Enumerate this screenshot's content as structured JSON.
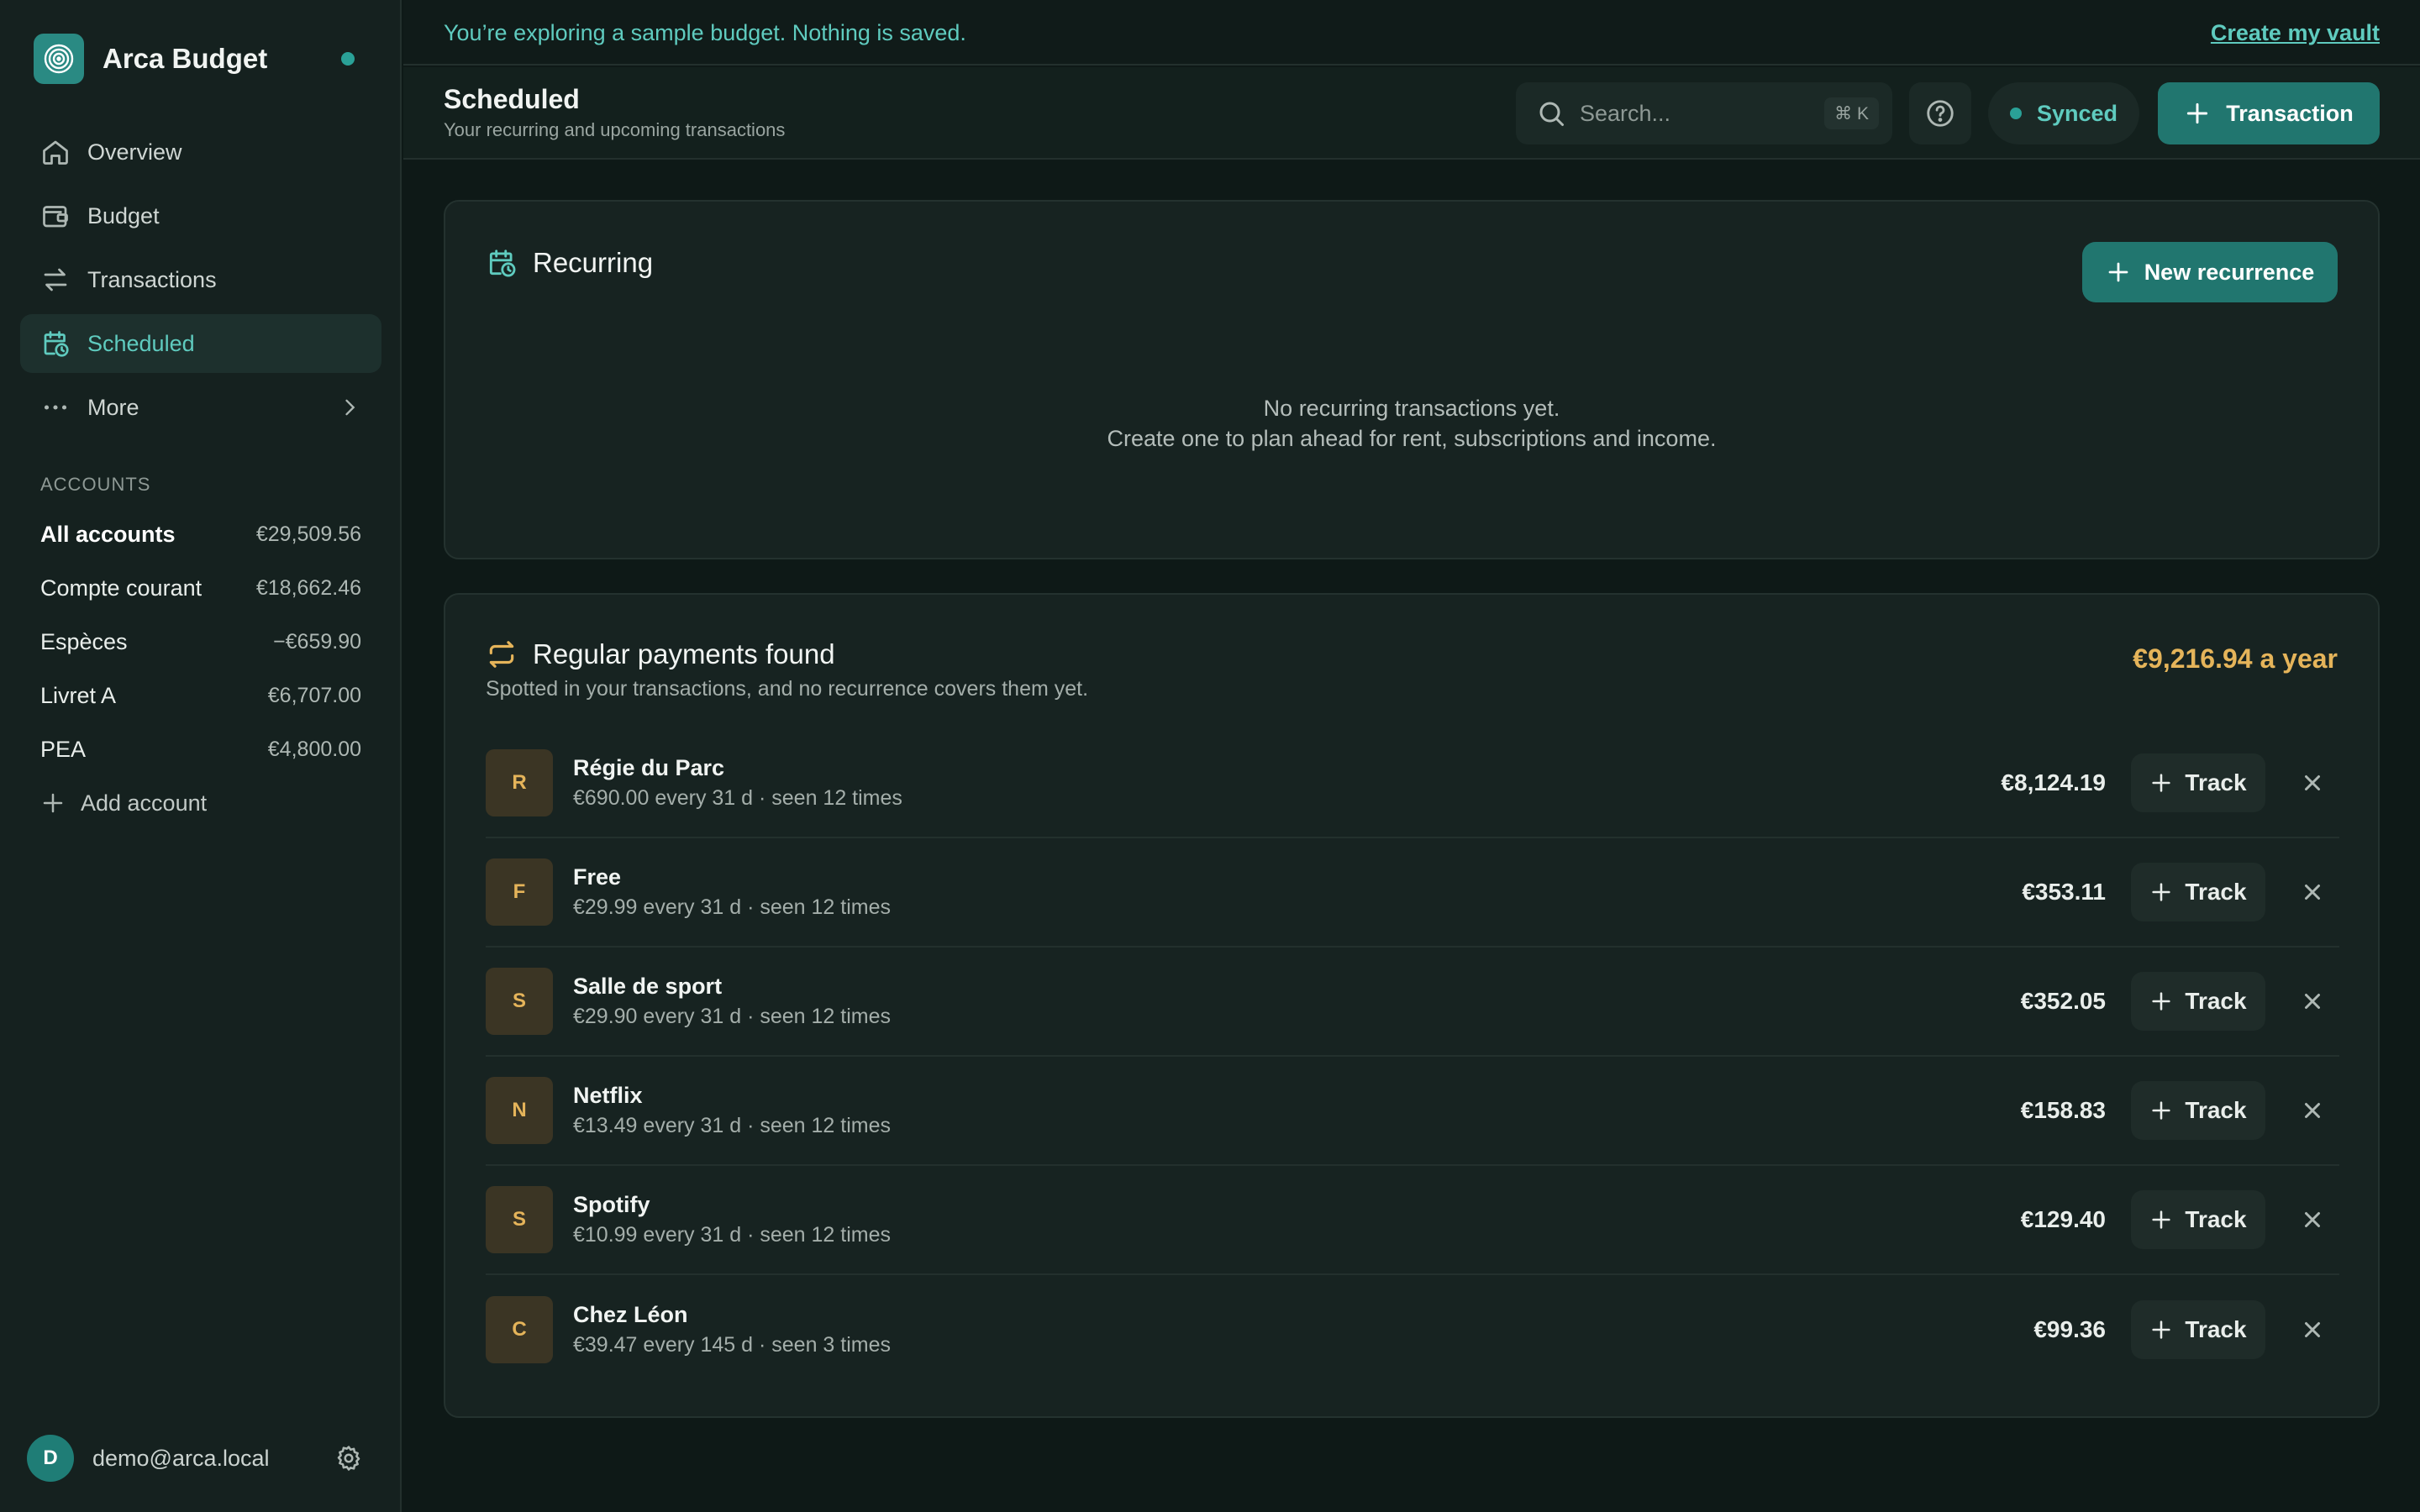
{
  "app": {
    "name": "Arca Budget"
  },
  "nav": [
    {
      "label": "Overview",
      "icon": "home-icon"
    },
    {
      "label": "Budget",
      "icon": "wallet-icon"
    },
    {
      "label": "Transactions",
      "icon": "arrows-icon"
    },
    {
      "label": "Scheduled",
      "icon": "calendar-clock-icon",
      "active": true
    },
    {
      "label": "More",
      "icon": "dots-icon"
    }
  ],
  "accounts": {
    "heading": "ACCOUNTS",
    "items": [
      {
        "name": "All accounts",
        "value": "€29,509.56"
      },
      {
        "name": "Compte courant",
        "value": "€18,662.46"
      },
      {
        "name": "Espèces",
        "value": "−€659.90"
      },
      {
        "name": "Livret A",
        "value": "€6,707.00"
      },
      {
        "name": "PEA",
        "value": "€4,800.00"
      }
    ],
    "add_label": "Add account"
  },
  "user": {
    "initial": "D",
    "email": "demo@arca.local"
  },
  "banner": {
    "text": "You’re exploring a sample budget. Nothing is saved.",
    "link": "Create my vault"
  },
  "header": {
    "title": "Scheduled",
    "subtitle": "Your recurring and upcoming transactions",
    "search_placeholder": "Search...",
    "search_shortcut": "⌘ K",
    "sync_status": "Synced",
    "transaction_button": "Transaction"
  },
  "recurring": {
    "title": "Recurring",
    "new_button": "New recurrence",
    "empty_line1": "No recurring transactions yet.",
    "empty_line2": "Create one to plan ahead for rent, subscriptions and income."
  },
  "regular": {
    "title": "Regular payments found",
    "subtitle": "Spotted in your transactions, and no recurrence covers them yet.",
    "yearly_total": "€9,216.94 a year",
    "track_label": "Track",
    "rows": [
      {
        "initial": "R",
        "name": "Régie du Parc",
        "detail": "€690.00 every 31 d · seen 12 times",
        "amount": "€8,124.19"
      },
      {
        "initial": "F",
        "name": "Free",
        "detail": "€29.99 every 31 d · seen 12 times",
        "amount": "€353.11"
      },
      {
        "initial": "S",
        "name": "Salle de sport",
        "detail": "€29.90 every 31 d · seen 12 times",
        "amount": "€352.05"
      },
      {
        "initial": "N",
        "name": "Netflix",
        "detail": "€13.49 every 31 d · seen 12 times",
        "amount": "€158.83"
      },
      {
        "initial": "S",
        "name": "Spotify",
        "detail": "€10.99 every 31 d · seen 12 times",
        "amount": "€129.40"
      },
      {
        "initial": "C",
        "name": "Chez Léon",
        "detail": "€39.47 every 145 d · seen 3 times",
        "amount": "€99.36"
      }
    ]
  },
  "colors": {
    "accent": "#5fcbbf",
    "primary_button": "#21766f",
    "highlight": "#e5b45a",
    "background": "#0e1917"
  }
}
